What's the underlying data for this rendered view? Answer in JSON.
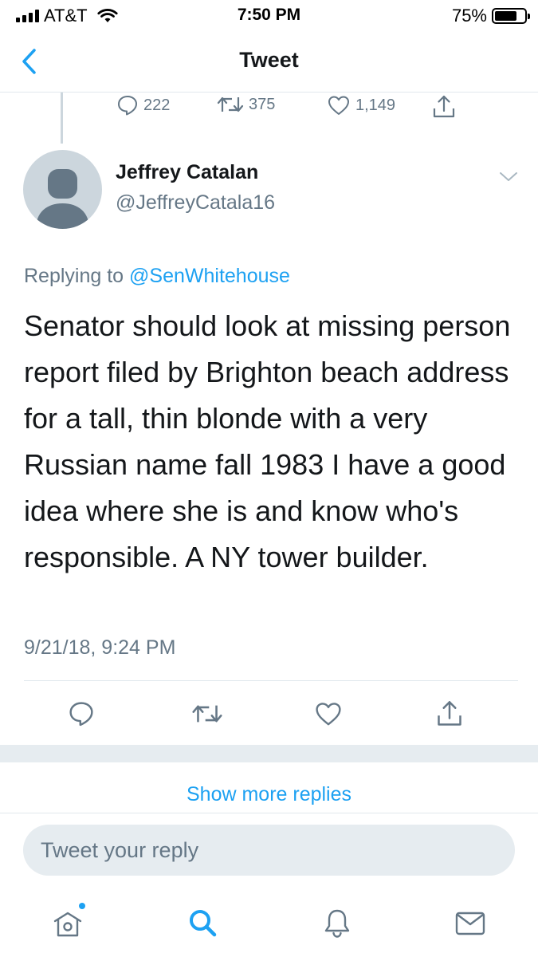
{
  "status_bar": {
    "carrier": "AT&T",
    "time": "7:50 PM",
    "battery_percent": "75%",
    "battery_level": 0.75
  },
  "nav": {
    "title": "Tweet",
    "back_icon": "chevron-left-icon"
  },
  "prior_tweet": {
    "reply_count": "222",
    "retweet_count": "375",
    "like_count": "1,149"
  },
  "tweet": {
    "author_name": "Jeffrey Catalan",
    "author_handle": "@JeffreyCatala16",
    "replying_prefix": "Replying to",
    "replying_to": "@SenWhitehouse",
    "text": "Senator should look at missing person report filed by Brighton beach address for a tall, thin blonde with a very Russian name fall 1983 I have a good idea where she is and know who's responsible. A NY tower builder.",
    "timestamp": "9/21/18, 9:24 PM"
  },
  "replies": {
    "show_more_label": "Show more replies"
  },
  "composer": {
    "placeholder": "Tweet your reply"
  },
  "tab_bar": {
    "items": [
      "home-icon",
      "search-icon",
      "notifications-bell-icon",
      "messages-envelope-icon"
    ],
    "active": "search-icon"
  },
  "colors": {
    "accent": "#1da1f2",
    "secondary_text": "#657786",
    "divider": "#e1e8ed",
    "band": "#e6ecf0"
  }
}
